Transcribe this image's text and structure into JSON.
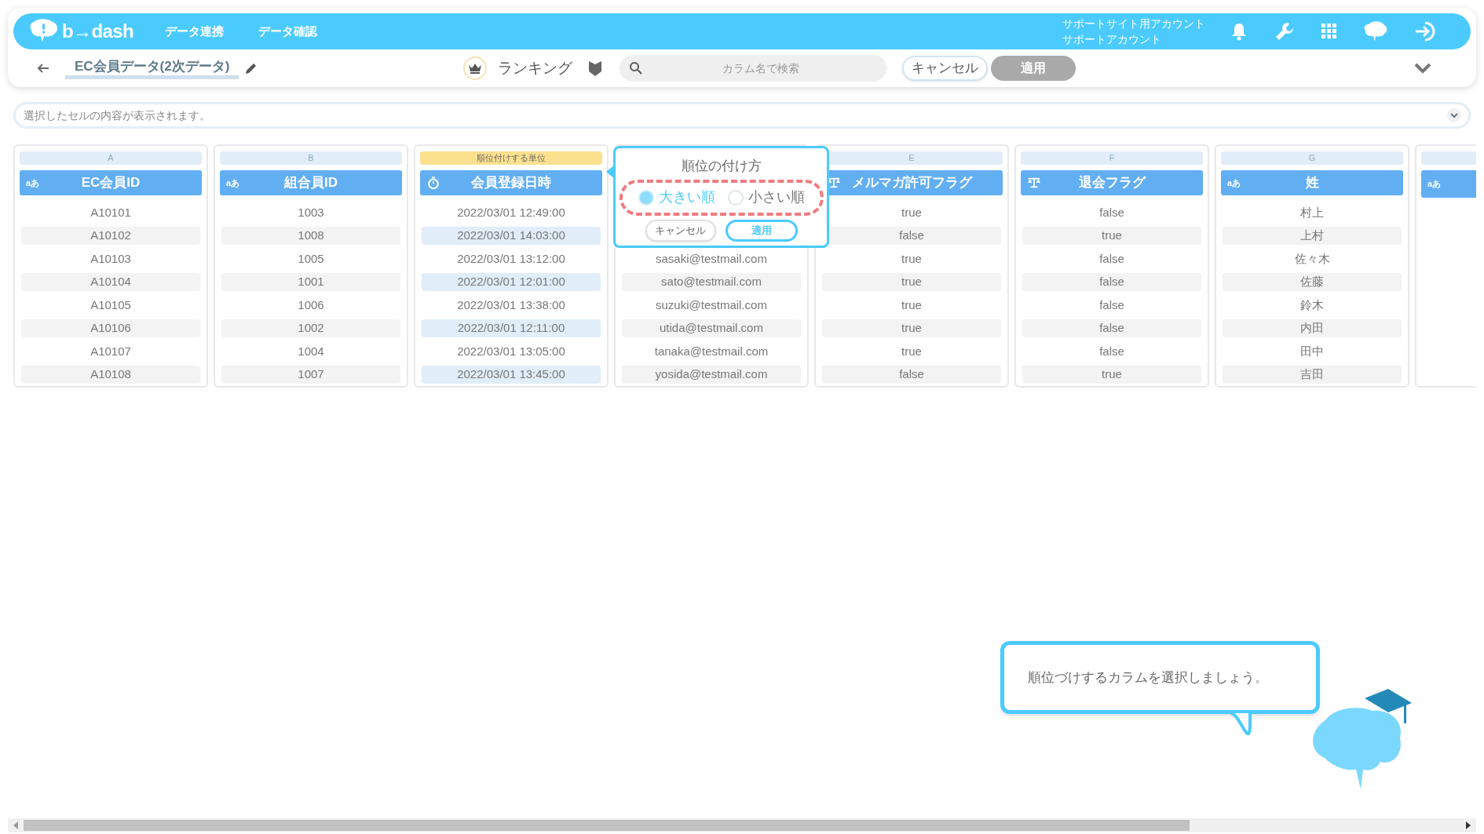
{
  "nav": {
    "logo": "b→dash",
    "links": [
      "データ連携",
      "データ確認"
    ],
    "account_lines": [
      "サポートサイト用アカウント",
      "サポートアカウント"
    ]
  },
  "toolbar": {
    "title": "EC会員データ(2次データ)",
    "mode": "ランキング",
    "search": {
      "placeholder": "カラム名で検索"
    },
    "cancel": "キャンセル",
    "apply": {
      "label": "適用",
      "disabled": true
    }
  },
  "cell_bar": {
    "placeholder": "選択したセルの内容が表示されます。"
  },
  "columns": [
    {
      "letter": "A",
      "kind": "text",
      "type_label": "aあ",
      "header": "EC会員ID",
      "selected": false,
      "cells": [
        "A10101",
        "A10102",
        "A10103",
        "A10104",
        "A10105",
        "A10106",
        "A10107",
        "A10108"
      ]
    },
    {
      "letter": "B",
      "kind": "text",
      "type_label": "aあ",
      "header": "組合員ID",
      "selected": false,
      "cells": [
        "1003",
        "1008",
        "1005",
        "1001",
        "1006",
        "1002",
        "1004",
        "1007"
      ]
    },
    {
      "unit_label": "順位付けする単位",
      "kind": "datetime",
      "header": "会員登録日時",
      "selected": true,
      "cells": [
        "2022/03/01 12:49:00",
        "2022/03/01 14:03:00",
        "2022/03/01 13:12:00",
        "2022/03/01 12:01:00",
        "2022/03/01 13:38:00",
        "2022/03/01 12:11:00",
        "2022/03/01 13:05:00",
        "2022/03/01 13:45:00"
      ]
    },
    {
      "kind": "hidden",
      "selected": false,
      "cells": [
        "sasaki@testmail.com",
        "sato@testmail.com",
        "suzuki@testmail.com",
        "utida@testmail.com",
        "tanaka@testmail.com",
        "yosida@testmail.com"
      ]
    },
    {
      "letter": "E",
      "kind": "boolean",
      "header": "メルマガ許可フラグ",
      "selected": false,
      "cells": [
        "true",
        "false",
        "true",
        "true",
        "true",
        "true",
        "true",
        "false"
      ]
    },
    {
      "letter": "F",
      "kind": "boolean",
      "header": "退会フラグ",
      "selected": false,
      "cells": [
        "false",
        "true",
        "false",
        "false",
        "false",
        "false",
        "false",
        "true"
      ]
    },
    {
      "letter": "G",
      "kind": "text",
      "type_label": "aあ",
      "header": "姓",
      "selected": false,
      "cells": [
        "村上",
        "上村",
        "佐々木",
        "佐藤",
        "鈴木",
        "内田",
        "田中",
        "吉田"
      ]
    },
    {
      "kind": "text",
      "type_label": "aあ"
    }
  ],
  "popup": {
    "title": "順位の付け方",
    "options": [
      {
        "label": "大きい順",
        "selected": true
      },
      {
        "label": "小さい順",
        "selected": false
      }
    ],
    "cancel": "キャンセル",
    "apply": "適用"
  },
  "guide": {
    "message": "順位づけするカラムを選択しましょう。"
  }
}
